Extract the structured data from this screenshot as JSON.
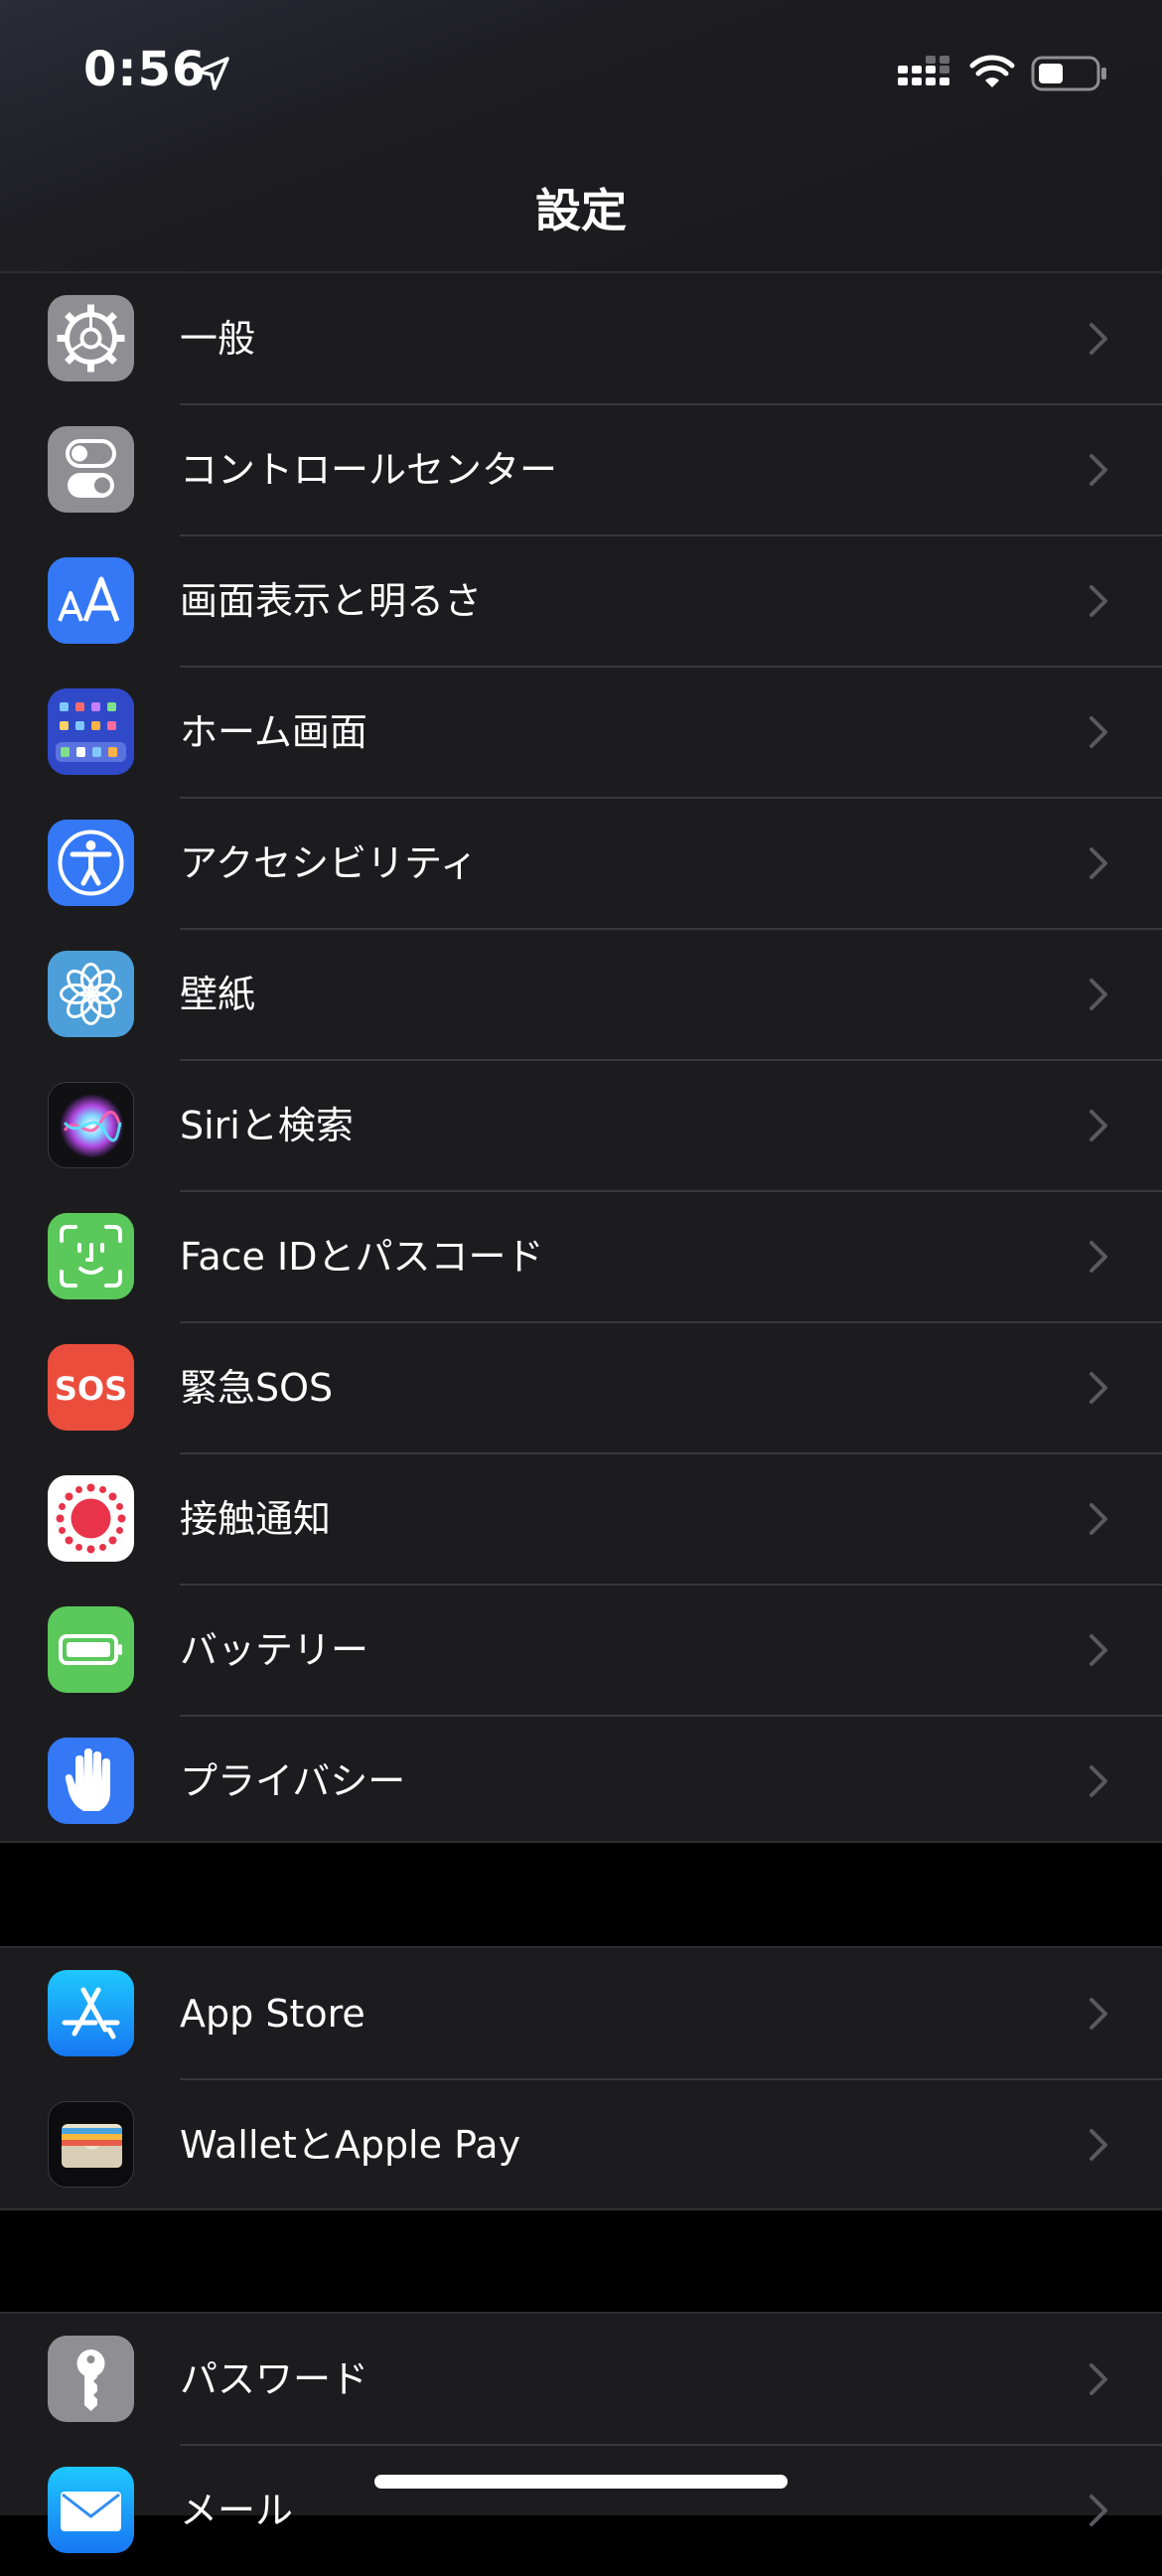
{
  "status_bar": {
    "time": "0:56",
    "icons": [
      "location-arrow-icon",
      "cellular-signal-icon",
      "wifi-icon",
      "battery-icon"
    ]
  },
  "nav": {
    "title": "設定"
  },
  "groups": [
    {
      "items": [
        {
          "label": "一般",
          "icon": "gear-icon"
        },
        {
          "label": "コントロールセンター",
          "icon": "toggles-icon"
        },
        {
          "label": "画面表示と明るさ",
          "icon": "text-size-icon"
        },
        {
          "label": "ホーム画面",
          "icon": "home-grid-icon"
        },
        {
          "label": "アクセシビリティ",
          "icon": "accessibility-icon"
        },
        {
          "label": "壁紙",
          "icon": "flower-icon"
        },
        {
          "label": "Siriと検索",
          "icon": "siri-icon"
        },
        {
          "label": "Face IDとパスコード",
          "icon": "face-id-icon"
        },
        {
          "label": "緊急SOS",
          "icon": "sos-icon",
          "icon_text": "SOS"
        },
        {
          "label": "接触通知",
          "icon": "exposure-icon"
        },
        {
          "label": "バッテリー",
          "icon": "battery-app-icon"
        },
        {
          "label": "プライバシー",
          "icon": "hand-icon"
        }
      ]
    },
    {
      "items": [
        {
          "label": "App Store",
          "icon": "app-store-icon"
        },
        {
          "label": "WalletとApple Pay",
          "icon": "wallet-icon"
        }
      ]
    },
    {
      "items": [
        {
          "label": "パスワード",
          "icon": "key-icon"
        },
        {
          "label": "メール",
          "icon": "mail-icon"
        }
      ]
    }
  ],
  "colors": {
    "background": "#000000",
    "cell": "#1c1c1e",
    "separator": "#38383a",
    "chevron": "#5a5a5e",
    "gear": "#8e8e93",
    "blue": "#3478f6",
    "green": "#5ac85a",
    "red": "#eb4d3d",
    "wallpaper": "#4c9fd8"
  }
}
